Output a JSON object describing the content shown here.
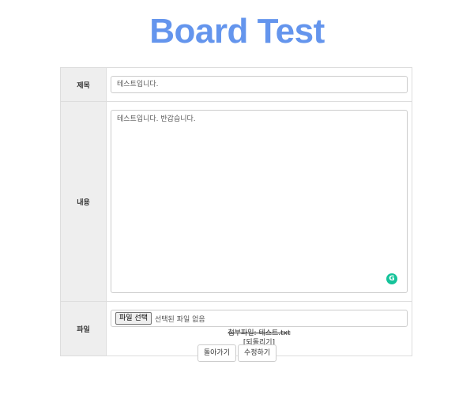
{
  "page": {
    "title": "Board Test"
  },
  "form": {
    "title_label": "제목",
    "title_value": "테스트입니다.",
    "content_label": "내용",
    "content_value": "테스트입니다. 반갑습니다.",
    "file_label": "파일",
    "file_button": "파일 선택",
    "file_status": "선택된 파일 없음",
    "attached_file": "첨부파일: 테스트.txt",
    "revert_link": "[되돌리기]"
  },
  "actions": {
    "back_label": "돌아가기",
    "edit_label": "수정하기"
  },
  "icons": {
    "grammarly": "grammarly-icon",
    "grammarly_letter": "G"
  },
  "colors": {
    "title": "#6495ed",
    "label_bg": "#eeeeee",
    "grammarly": "#15c39a"
  }
}
